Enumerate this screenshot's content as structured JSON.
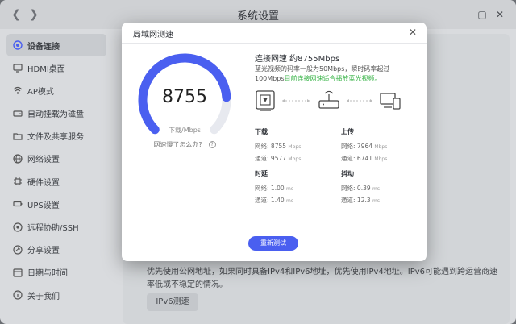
{
  "window": {
    "title": "系统设置"
  },
  "sidebar": {
    "items": [
      {
        "label": "设备连接",
        "active": true
      },
      {
        "label": "HDMI桌面"
      },
      {
        "label": "AP模式"
      },
      {
        "label": "自动挂载为磁盘"
      },
      {
        "label": "文件及共享服务"
      },
      {
        "label": "网络设置"
      },
      {
        "label": "硬件设置"
      },
      {
        "label": "UPS设置"
      },
      {
        "label": "远程协助/SSH"
      },
      {
        "label": "分享设置"
      },
      {
        "label": "日期与时间"
      },
      {
        "label": "关于我们"
      }
    ]
  },
  "background": {
    "description": "优先使用公网地址，如果同时具备IPv4和IPv6地址，优先使用IPv4地址。IPv6可能遇到跨运营商速率低或不稳定的情况。",
    "ipv6_button": "IPv6测速"
  },
  "modal": {
    "title": "局域网测速",
    "gauge": {
      "value": "8755",
      "unit": "下载/Mbps",
      "fill": 0.82,
      "color": "#4a5ff0"
    },
    "slow_link": "网速慢了怎么办?",
    "connection": {
      "title": "连接网速 约8755Mbps",
      "desc": "蓝光视频的码率一般为50Mbps，瞬时码率超过100Mbps",
      "desc_ok": "目前连接网速适合播放蓝光视频。"
    },
    "stats": {
      "download": {
        "title": "下载",
        "network_label": "网络:",
        "network_value": "8755",
        "channel_label": "通道:",
        "channel_value": "9577",
        "unit": "Mbps"
      },
      "upload": {
        "title": "上传",
        "network_label": "网络:",
        "network_value": "7964",
        "channel_label": "通道:",
        "channel_value": "6741",
        "unit": "Mbps"
      },
      "latency": {
        "title": "时延",
        "network_label": "网络:",
        "network_value": "1.00",
        "channel_label": "通道:",
        "channel_value": "1.40",
        "unit": "ms"
      },
      "jitter": {
        "title": "抖动",
        "network_label": "网络:",
        "network_value": "0.39",
        "channel_label": "通道:",
        "channel_value": "12.3",
        "unit": "ms"
      }
    },
    "retest_button": "重新测试",
    "accent": "#4a5ff0",
    "ok_color": "#3bb54a"
  }
}
